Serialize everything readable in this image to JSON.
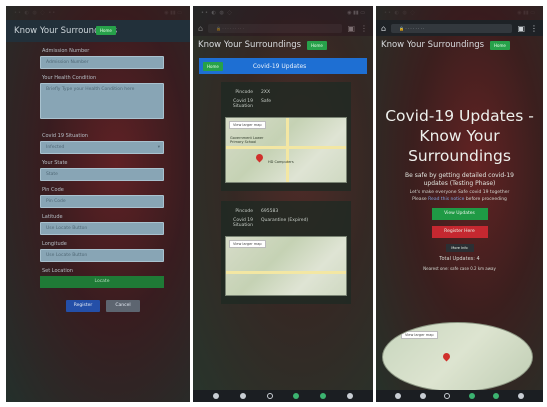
{
  "app": {
    "brand": "Know Your Surroundings",
    "nav_pill": "Home"
  },
  "panel1": {
    "labels": [
      "Admission Number",
      "Your Health Condition",
      "Covid 19 Situation",
      "Your State",
      "Pin Code",
      "Latitude",
      "Longitude",
      "Set Location"
    ],
    "fields": {
      "admission": "Admission Number",
      "health": "Briefly Type your Health Condition here",
      "situation": "Infected",
      "state": "State",
      "pincode": "Pin Code",
      "latitude": "Use Locate Button",
      "longitude": "Use Locate Button"
    },
    "locate_label": "Locate",
    "register_label": "Register",
    "cancel_label": "Cancel"
  },
  "panel2": {
    "banner_pill": "Home",
    "banner_title": "Covid-19 Updates",
    "cards": [
      {
        "pincode_key": "Pincode",
        "pincode_val": "2XX",
        "situation_key": "Covid 19 Situation",
        "situation_val": "Safe",
        "map_btn": "View larger map",
        "map_label1": "Government Lower Primary School",
        "map_label2": "HD Computers"
      },
      {
        "pincode_key": "Pincode",
        "pincode_val": "695583",
        "situation_key": "Covid 19 Situation",
        "situation_val": "Quarantine (Expired)",
        "map_btn": "View larger map"
      }
    ]
  },
  "panel3": {
    "title": "Covid-19 Updates - Know Your Surroundings",
    "subtitle": "Be safe by getting detailed covid-19 updates (Testing Phase)",
    "line1": "Let's make everyone Safe covid 19 together",
    "line2_pre": "Please",
    "line2_link": "Read this notice",
    "line2_post": "before proceeding",
    "btn_updates": "View Updates",
    "btn_register": "Register Here",
    "btn_info": "More Info",
    "total_updates": "Total Updates: 4",
    "nearest": "Nearest one: safe case 0.2 km away",
    "map_btn": "View larger map"
  }
}
